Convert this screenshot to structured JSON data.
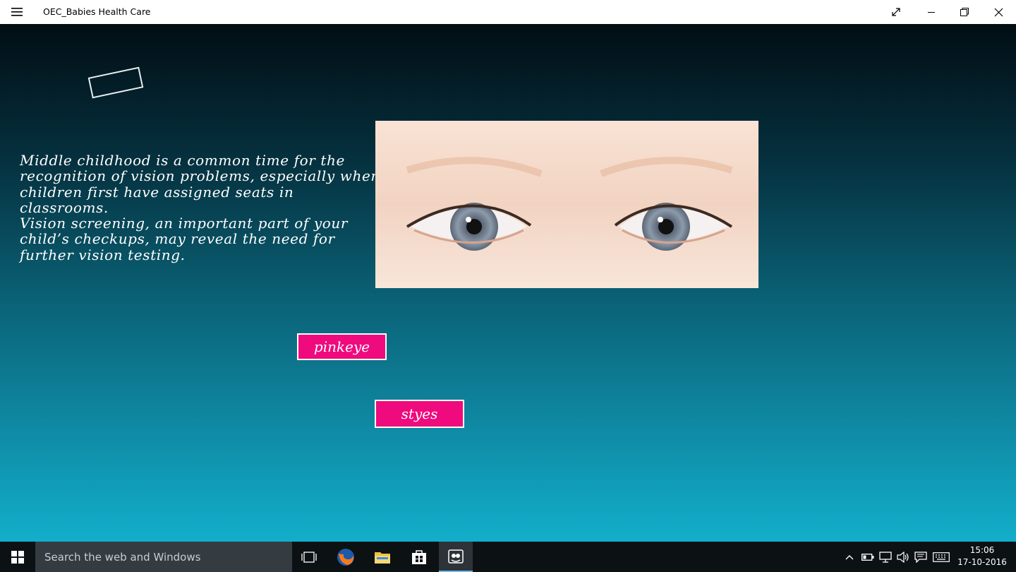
{
  "window": {
    "title": "OEC_Babies Health Care",
    "controls": [
      "menu-icon",
      "fullscreen-icon",
      "minimize-icon",
      "restore-icon",
      "close-icon"
    ]
  },
  "content": {
    "paragraph_1": "Middle childhood is a common time for the recognition of vision problems, especially when children first have assigned seats in classrooms.",
    "paragraph_2": "Vision screening,  an  important part of your child’s checkups, may reveal the need for further vision testing.",
    "image_icon": "baby-eyes-photo",
    "buttons": {
      "pinkeye": "pinkeye",
      "styes": "styes"
    },
    "colors": {
      "button_bg": "#ef0a7e",
      "gradient_top": "#020e14",
      "gradient_bottom": "#12aecb"
    }
  },
  "taskbar": {
    "search_placeholder": "Search the web and Windows",
    "time": "15:06",
    "date": "17-10-2016",
    "pinned_icons": [
      "task-view-icon",
      "firefox-icon",
      "file-explorer-icon",
      "store-icon",
      "app-icon"
    ],
    "tray_icons": [
      "chevron-up-icon",
      "battery-icon",
      "network-icon",
      "volume-icon",
      "notification-icon",
      "keyboard-icon"
    ]
  }
}
